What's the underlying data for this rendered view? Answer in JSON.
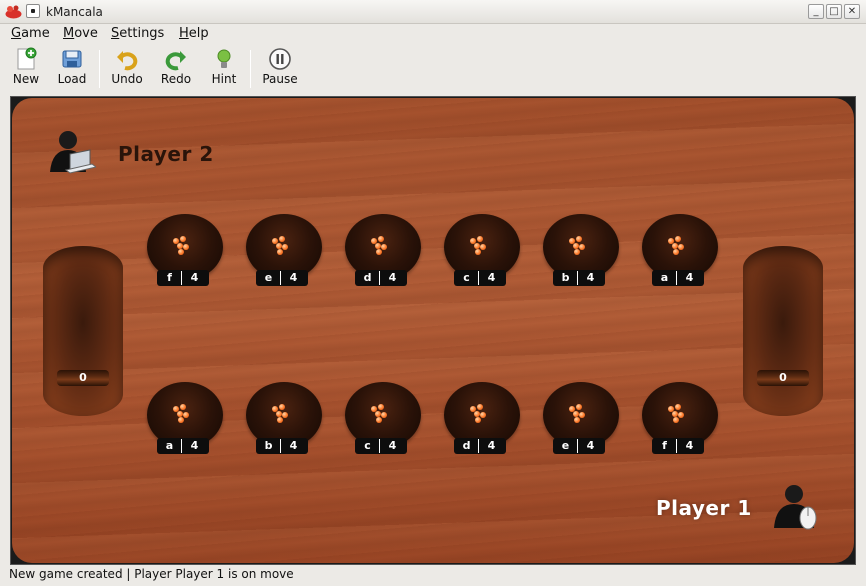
{
  "window": {
    "title": "kMancala",
    "minimize": "_",
    "maximize": "□",
    "close": "✕",
    "app_icon": "kmancala-app-icon"
  },
  "menu": [
    {
      "label": "Game",
      "accel": "G",
      "rest": "ame"
    },
    {
      "label": "Move",
      "accel": "M",
      "rest": "ove"
    },
    {
      "label": "Settings",
      "accel": "S",
      "rest": "ettings"
    },
    {
      "label": "Help",
      "accel": "H",
      "rest": "elp"
    }
  ],
  "toolbar": [
    {
      "label": "New",
      "icon": "new-document-icon"
    },
    {
      "label": "Load",
      "icon": "load-icon"
    },
    {
      "label": "Undo",
      "icon": "undo-icon"
    },
    {
      "label": "Redo",
      "icon": "redo-icon"
    },
    {
      "label": "Hint",
      "icon": "lightbulb-icon"
    },
    {
      "label": "Pause",
      "icon": "pause-icon"
    }
  ],
  "board": {
    "player2": {
      "name": "Player 2",
      "type": "computer",
      "icon": "computer-player-icon"
    },
    "player1": {
      "name": "Player 1",
      "type": "human",
      "icon": "human-player-icon"
    },
    "store_left": "0",
    "store_right": "0",
    "top_row": [
      {
        "letter": "f",
        "count": "4"
      },
      {
        "letter": "e",
        "count": "4"
      },
      {
        "letter": "d",
        "count": "4"
      },
      {
        "letter": "c",
        "count": "4"
      },
      {
        "letter": "b",
        "count": "4"
      },
      {
        "letter": "a",
        "count": "4"
      }
    ],
    "bottom_row": [
      {
        "letter": "a",
        "count": "4"
      },
      {
        "letter": "b",
        "count": "4"
      },
      {
        "letter": "c",
        "count": "4"
      },
      {
        "letter": "d",
        "count": "4"
      },
      {
        "letter": "e",
        "count": "4"
      },
      {
        "letter": "f",
        "count": "4"
      }
    ],
    "seed_color": "#ff7a2a"
  },
  "status": "New game created | Player Player 1 is on move"
}
